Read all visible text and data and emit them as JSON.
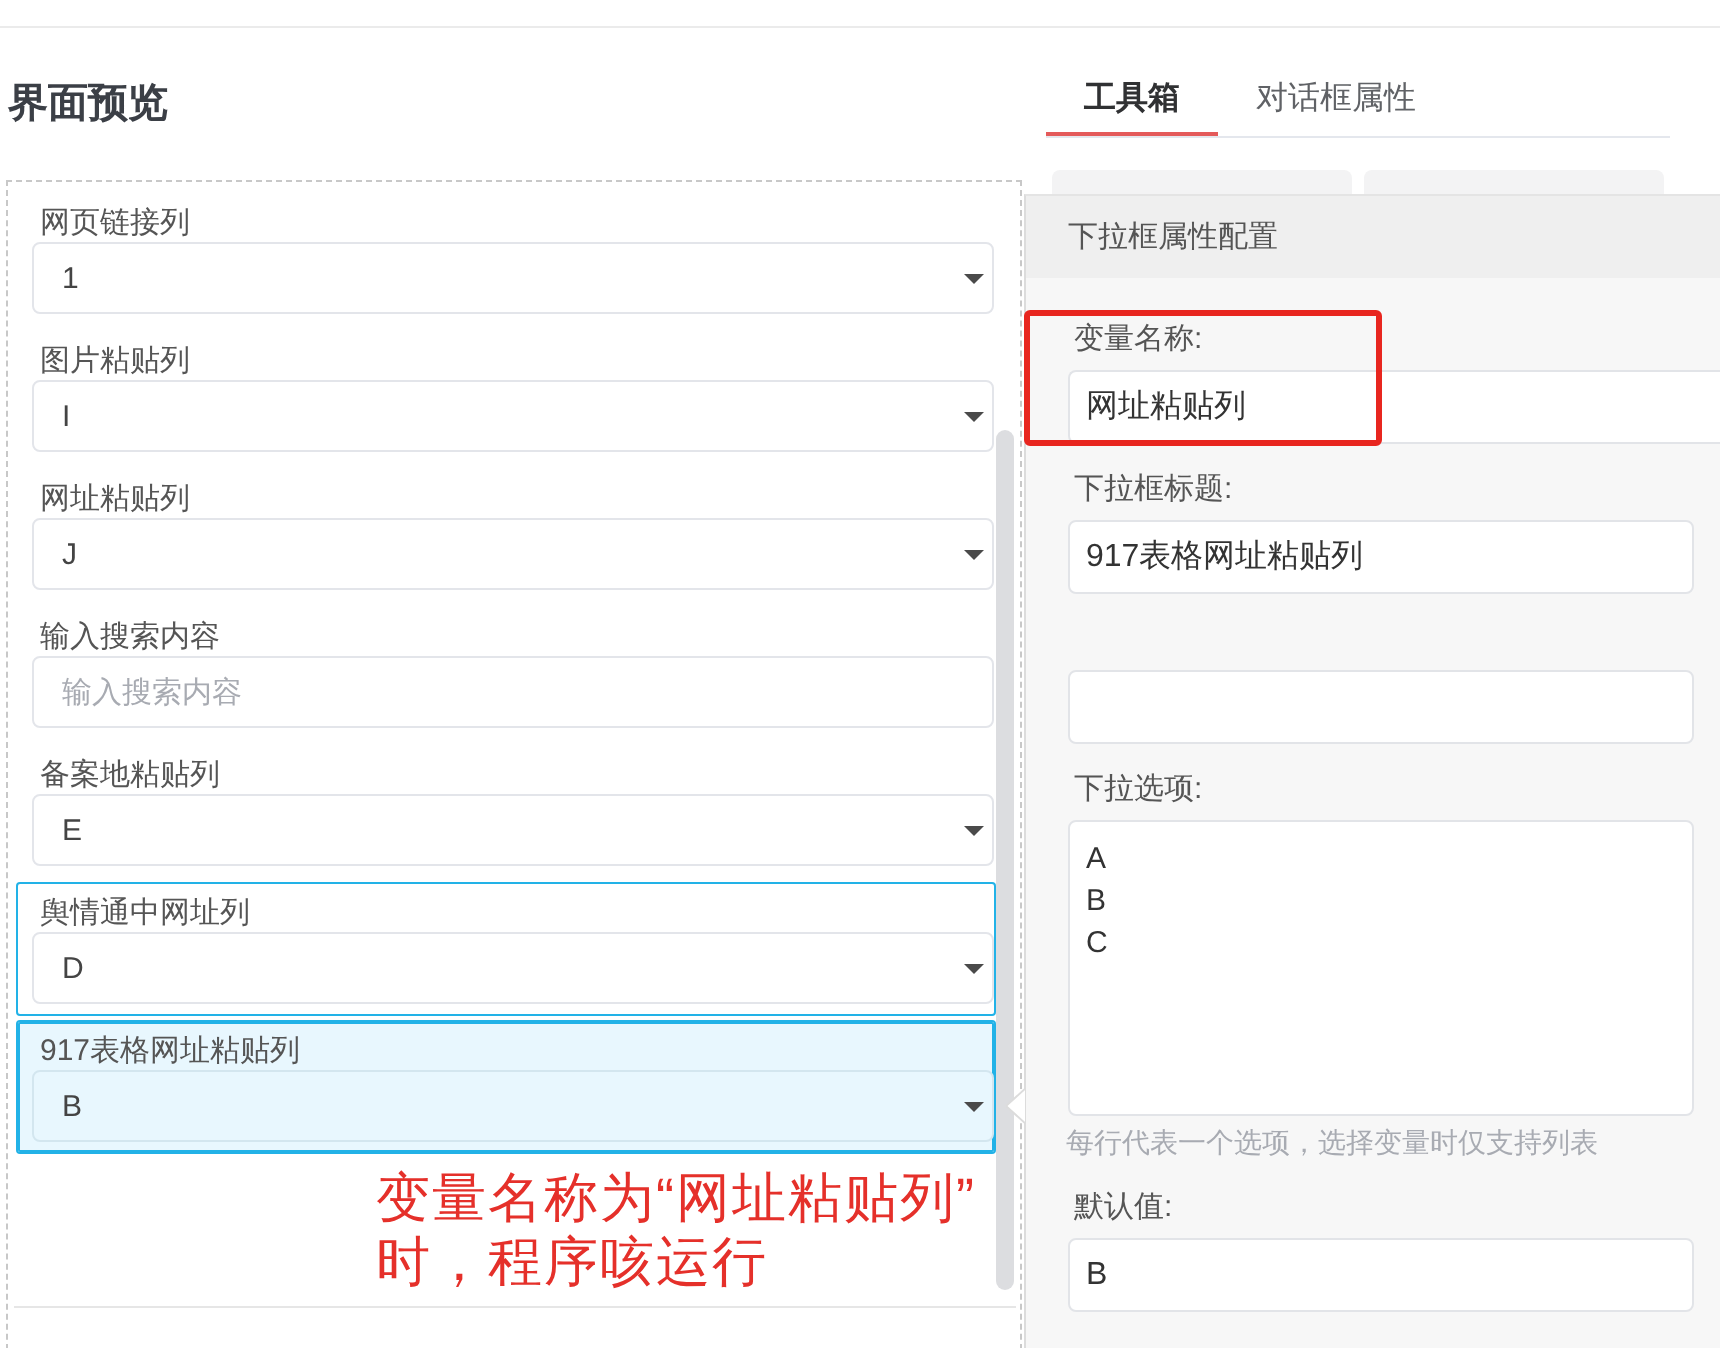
{
  "page_title": "界面预览",
  "preview_items": [
    {
      "kind": "select",
      "label": "网页链接列",
      "value": "1",
      "selected": false,
      "hovered": false
    },
    {
      "kind": "select",
      "label": "图片粘贴列",
      "value": "I",
      "selected": false,
      "hovered": false
    },
    {
      "kind": "select",
      "label": "网址粘贴列",
      "value": "J",
      "selected": false,
      "hovered": false
    },
    {
      "kind": "input",
      "label": "输入搜索内容",
      "placeholder": "输入搜索内容",
      "selected": false,
      "hovered": false
    },
    {
      "kind": "select",
      "label": "备案地粘贴列",
      "value": "E",
      "selected": false,
      "hovered": false
    },
    {
      "kind": "select",
      "label": "舆情通中网址列",
      "value": "D",
      "selected": false,
      "hovered": true
    },
    {
      "kind": "select",
      "label": "917表格网址粘贴列",
      "value": "B",
      "selected": true,
      "hovered": false
    }
  ],
  "tabs": [
    {
      "label": "工具箱",
      "selected": true
    },
    {
      "label": "对话框属性",
      "selected": false
    }
  ],
  "popover": {
    "title": "下拉框属性配置",
    "fields": [
      {
        "kind": "input",
        "label": "变量名称:",
        "value": "网址粘贴列"
      },
      {
        "kind": "input",
        "label": "下拉框标题:",
        "value": "917表格网址粘贴列"
      },
      {
        "kind": "input"
      },
      {
        "kind": "textarea",
        "label": "下拉选项:",
        "lines": [
          "A",
          "B",
          "C"
        ],
        "hint": "每行代表一个选项，选择变量时仅支持列表"
      },
      {
        "kind": "input",
        "label": "默认值:",
        "value": "B"
      }
    ]
  },
  "annotation": {
    "lines": [
      "变量名称为“网址粘贴列”",
      "时，程序咳运行"
    ],
    "outline": true
  }
}
